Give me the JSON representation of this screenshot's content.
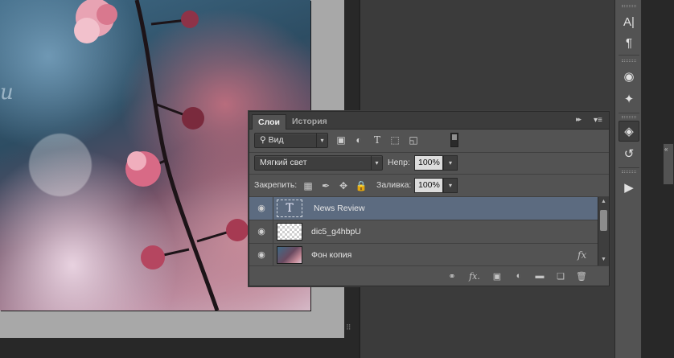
{
  "canvas": {
    "script_text": "u",
    "resize_grip": "⠿"
  },
  "layers_panel": {
    "tabs": [
      {
        "label": "Слои",
        "active": true
      },
      {
        "label": "История",
        "active": false
      }
    ],
    "collapse_glyph": "▸▸",
    "menu_glyph": "▾≡",
    "filter": {
      "kind_label": "Вид",
      "icons": [
        "image-filter-icon",
        "adjustment-filter-icon",
        "type-filter-icon",
        "shape-filter-icon",
        "smart-object-filter-icon"
      ]
    },
    "blend_mode": "Мягкий свет",
    "opacity_label": "Непр:",
    "opacity_value": "100%",
    "lock_label": "Закрепить:",
    "fill_label": "Заливка:",
    "fill_value": "100%",
    "layers": [
      {
        "name": "News Review",
        "type": "text",
        "selected": true,
        "visible": true,
        "thumb_glyph": "T",
        "fx": ""
      },
      {
        "name": "dic5_g4hbpU",
        "type": "transparent",
        "selected": false,
        "visible": true,
        "thumb_glyph": "",
        "fx": ""
      },
      {
        "name": "Фон копия",
        "type": "photo",
        "selected": false,
        "visible": true,
        "thumb_glyph": "",
        "fx": "fx"
      }
    ],
    "bottom_icons": [
      "link-layers-icon",
      "fx-icon",
      "add-mask-icon",
      "adjustment-layer-icon",
      "new-group-icon",
      "new-layer-icon",
      "delete-layer-icon"
    ]
  },
  "dock": {
    "buttons": [
      "character-icon",
      "paragraph-icon",
      "channels-icon",
      "paths-icon",
      "layers-icon",
      "history-icon",
      "actions-icon"
    ],
    "active": "layers-icon"
  },
  "side_tab_label": "«"
}
